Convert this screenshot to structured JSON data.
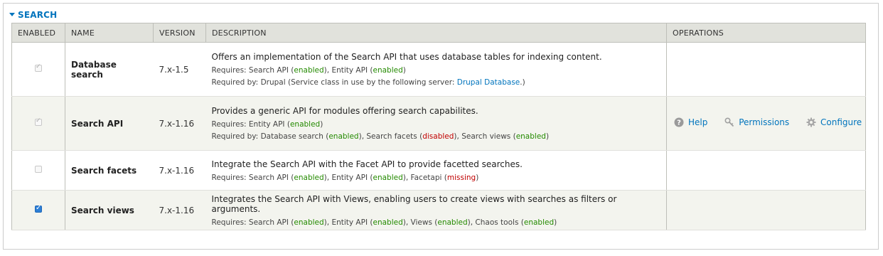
{
  "section": {
    "title": "SEARCH"
  },
  "columns": {
    "enabled": "ENABLED",
    "name": "NAME",
    "version": "VERSION",
    "description": "DESCRIPTION",
    "operations": "OPERATIONS"
  },
  "modules": [
    {
      "enabled": true,
      "disabled": true,
      "name": "Database search",
      "version": "7.x-1.5",
      "description": "Offers an implementation of the Search API that uses database tables for indexing content.",
      "requires_label": "Requires:",
      "requires": [
        {
          "name": "Search API",
          "status": "enabled"
        },
        {
          "name": "Entity API",
          "status": "enabled"
        }
      ],
      "required_by_label": "Required by:",
      "required_by_text": "Drupal (Service class in use by the following server:",
      "required_by_link": "Drupal Database",
      "required_by_end": ".)"
    },
    {
      "enabled": true,
      "disabled": true,
      "name": "Search API",
      "version": "7.x-1.16",
      "description": "Provides a generic API for modules offering search capabilites.",
      "requires_label": "Requires:",
      "requires": [
        {
          "name": "Entity API",
          "status": "enabled"
        }
      ],
      "required_by_label": "Required by:",
      "required_by": [
        {
          "name": "Database search",
          "status": "enabled"
        },
        {
          "name": "Search facets",
          "status": "disabled"
        },
        {
          "name": "Search views",
          "status": "enabled"
        }
      ],
      "operations": {
        "help": "Help",
        "permissions": "Permissions",
        "configure": "Configure"
      }
    },
    {
      "enabled": false,
      "disabled": true,
      "name": "Search facets",
      "version": "7.x-1.16",
      "description": "Integrate the Search API with the Facet API to provide facetted searches.",
      "requires_label": "Requires:",
      "requires": [
        {
          "name": "Search API",
          "status": "enabled"
        },
        {
          "name": "Entity API",
          "status": "enabled"
        },
        {
          "name": "Facetapi",
          "status": "missing"
        }
      ]
    },
    {
      "enabled": true,
      "disabled": false,
      "name": "Search views",
      "version": "7.x-1.16",
      "description": "Integrates the Search API with Views, enabling users to create views with searches as filters or arguments.",
      "requires_label": "Requires:",
      "requires": [
        {
          "name": "Search API",
          "status": "enabled"
        },
        {
          "name": "Entity API",
          "status": "enabled"
        },
        {
          "name": "Views",
          "status": "enabled"
        },
        {
          "name": "Chaos tools",
          "status": "enabled"
        }
      ]
    }
  ],
  "icons": {
    "help": "help-circle-icon",
    "permissions": "key-icon",
    "configure": "gear-icon"
  },
  "colors": {
    "link": "#0074bd",
    "enabled": "#248a00",
    "problem": "#c00000",
    "header_bg": "#e1e2dc",
    "even_row_bg": "#f3f4ee"
  }
}
